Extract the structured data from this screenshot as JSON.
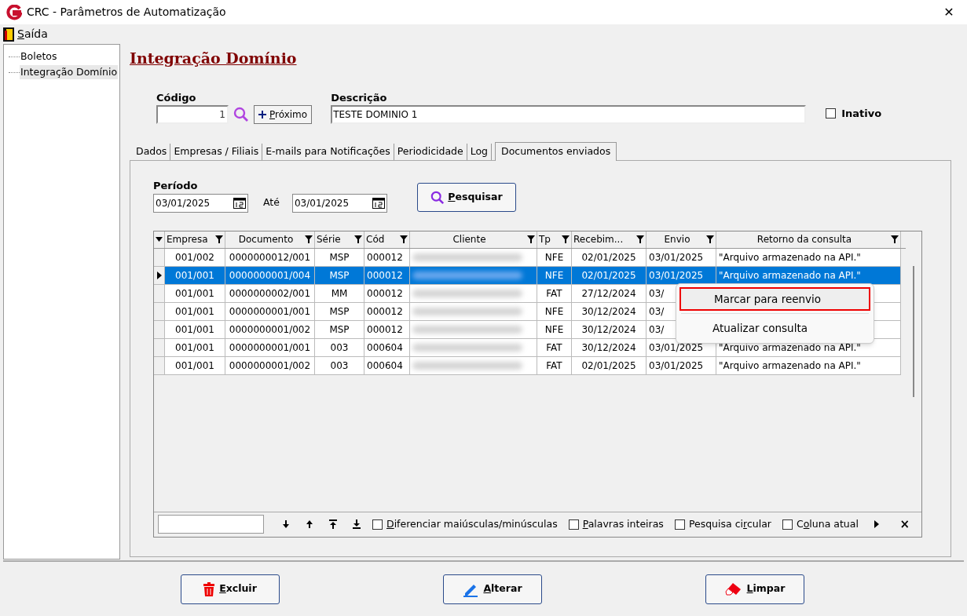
{
  "window": {
    "title": "CRC - Parâmetros de Automatização",
    "close": "✕"
  },
  "menu": [
    {
      "label_parts": {
        "key": "S",
        "after": "aída"
      }
    }
  ],
  "tree": [
    {
      "label": "Boletos",
      "selected": false
    },
    {
      "label": "Integração Domínio",
      "selected": true
    }
  ],
  "heading": "Integração Domínio",
  "codigo": {
    "label": "Código",
    "value": "1"
  },
  "next_button": {
    "label_parts": {
      "key": "P",
      "after": "róximo"
    }
  },
  "descricao": {
    "label": "Descrição",
    "value": "TESTE DOMINIO 1"
  },
  "inativo": {
    "label": "Inativo",
    "checked": false
  },
  "tabs": [
    {
      "label": "Dados",
      "selected": false
    },
    {
      "label": "Empresas / Filiais",
      "selected": false
    },
    {
      "label": "E-mails para Notificações",
      "selected": false
    },
    {
      "label": "Periodicidade",
      "selected": false
    },
    {
      "label": "Log",
      "selected": false
    },
    {
      "label": "Documentos enviados",
      "selected": true
    }
  ],
  "periodo": {
    "label": "Período",
    "from": "03/01/2025",
    "to_label": "Até",
    "to": "03/01/2025"
  },
  "search_button": {
    "label_parts": {
      "key": "P",
      "after": "esquisar"
    }
  },
  "table": {
    "columns": [
      {
        "label": "Empresa"
      },
      {
        "label": "Documento"
      },
      {
        "label": "Série"
      },
      {
        "label": "Cód"
      },
      {
        "label": "Cliente"
      },
      {
        "label": "Tp"
      },
      {
        "label": "Recebim..."
      },
      {
        "label": "Envio"
      },
      {
        "label": "Retorno da consulta"
      }
    ],
    "rows": [
      {
        "selected": false,
        "cells": [
          "001/002",
          "0000000012/001",
          "MSP",
          "000012",
          "",
          "NFE",
          "02/01/2025",
          "03/01/2025",
          "\"Arquivo armazenado na API.\""
        ]
      },
      {
        "selected": true,
        "cells": [
          "001/001",
          "0000000001/004",
          "MSP",
          "000012",
          "",
          "NFE",
          "02/01/2025",
          "03/01/2025",
          "\"Arquivo armazenado na API.\""
        ]
      },
      {
        "selected": false,
        "cells": [
          "001/001",
          "0000000002/001",
          "MM",
          "000012",
          "",
          "FAT",
          "27/12/2024",
          "03/",
          ""
        ]
      },
      {
        "selected": false,
        "cells": [
          "001/001",
          "0000000001/001",
          "MSP",
          "000012",
          "",
          "NFE",
          "30/12/2024",
          "03/",
          ""
        ]
      },
      {
        "selected": false,
        "cells": [
          "001/001",
          "0000000001/002",
          "MSP",
          "000012",
          "",
          "NFE",
          "30/12/2024",
          "03/",
          ""
        ]
      },
      {
        "selected": false,
        "cells": [
          "001/001",
          "0000000001/001",
          "003",
          "000604",
          "",
          "FAT",
          "30/12/2024",
          "03/01/2025",
          "\"Arquivo armazenado na API.\""
        ]
      },
      {
        "selected": false,
        "cells": [
          "001/001",
          "0000000001/002",
          "003",
          "000604",
          "",
          "FAT",
          "02/01/2025",
          "03/01/2025",
          "\"Arquivo armazenado na API.\""
        ]
      }
    ]
  },
  "context_menu": [
    {
      "label": "Marcar para reenvio",
      "highlighted": true
    },
    {
      "label": "Atualizar consulta",
      "highlighted": false
    }
  ],
  "find_bar": {
    "options": [
      {
        "label_parts": {
          "key": "D",
          "after": "iferenciar maiúsculas/minúsculas"
        },
        "checked": false
      },
      {
        "label_parts": {
          "key": "P",
          "after": "alavras inteiras"
        },
        "checked": false
      },
      {
        "label_parts": {
          "before": "Pesquisa ci",
          "key": "r",
          "after": "cular"
        },
        "checked": false
      },
      {
        "label_parts": {
          "before": "C",
          "key": "o",
          "after": "luna atual"
        },
        "checked": false
      }
    ],
    "close": "×"
  },
  "actions": [
    {
      "kind": "delete",
      "label_parts": {
        "key": "E",
        "after": "xcluir"
      }
    },
    {
      "kind": "edit",
      "label_parts": {
        "key": "A",
        "after": "lterar"
      }
    },
    {
      "kind": "clear",
      "label_parts": {
        "key": "L",
        "after": "impar"
      }
    }
  ]
}
